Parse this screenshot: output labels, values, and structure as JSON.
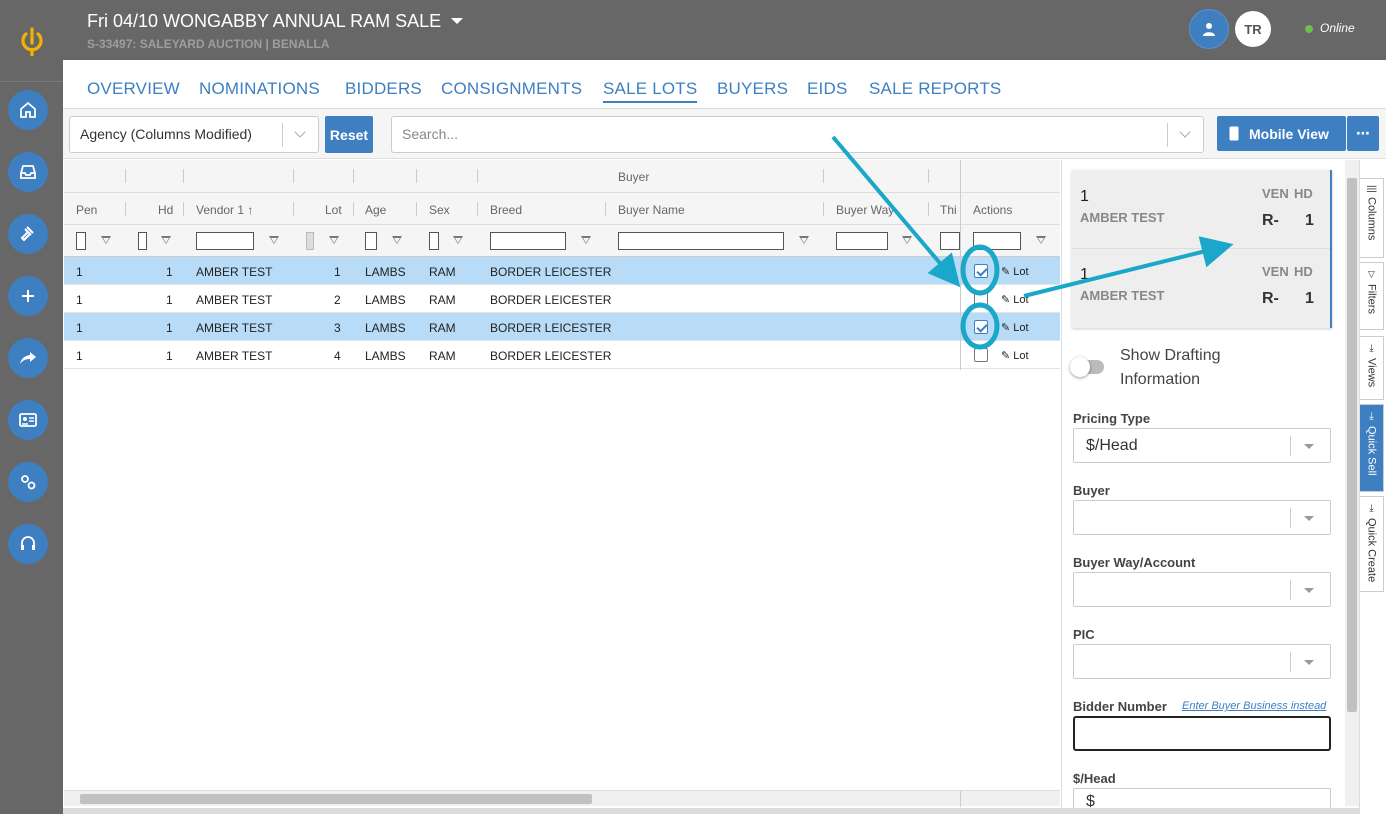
{
  "header": {
    "title": "Fri 04/10 WONGABBY ANNUAL RAM SALE",
    "subtitle": "S-33497: SALEYARD AUCTION | BENALLA",
    "avatar_initials": "TR",
    "status": "Online"
  },
  "sidebar": {
    "items": [
      {
        "icon": "home-icon"
      },
      {
        "icon": "inbox-icon"
      },
      {
        "icon": "gavel-icon"
      },
      {
        "icon": "plus-icon"
      },
      {
        "icon": "share-icon"
      },
      {
        "icon": "id-card-icon"
      },
      {
        "icon": "settings-icon"
      },
      {
        "icon": "headset-icon"
      }
    ]
  },
  "tabs": [
    {
      "label": "OVERVIEW"
    },
    {
      "label": "NOMINATIONS"
    },
    {
      "label": "BIDDERS"
    },
    {
      "label": "CONSIGNMENTS"
    },
    {
      "label": "SALE LOTS",
      "active": true
    },
    {
      "label": "BUYERS"
    },
    {
      "label": "EIDS"
    },
    {
      "label": "SALE REPORTS"
    }
  ],
  "toolbar": {
    "view_select": "Agency (Columns Modified)",
    "reset_label": "Reset",
    "search_placeholder": "Search...",
    "mobile_view_label": "Mobile View",
    "more_label": "⋯"
  },
  "grid": {
    "group_header": "Buyer",
    "columns": [
      "Pen",
      "Hd",
      "Vendor 1",
      "Lot",
      "Age",
      "Sex",
      "Breed",
      "Buyer Name",
      "Buyer Way",
      "Thi",
      "Actions"
    ],
    "sort_indicator": "↑",
    "rows": [
      {
        "pen": "1",
        "hd": "1",
        "vendor": "AMBER TEST",
        "lot": "1",
        "age": "LAMBS",
        "sex": "RAM",
        "breed": "BORDER LEICESTER",
        "checked": true,
        "action": "Lot"
      },
      {
        "pen": "1",
        "hd": "1",
        "vendor": "AMBER TEST",
        "lot": "2",
        "age": "LAMBS",
        "sex": "RAM",
        "breed": "BORDER LEICESTER",
        "checked": false,
        "action": "Lot"
      },
      {
        "pen": "1",
        "hd": "1",
        "vendor": "AMBER TEST",
        "lot": "3",
        "age": "LAMBS",
        "sex": "RAM",
        "breed": "BORDER LEICESTER",
        "checked": true,
        "action": "Lot"
      },
      {
        "pen": "1",
        "hd": "1",
        "vendor": "AMBER TEST",
        "lot": "4",
        "age": "LAMBS",
        "sex": "RAM",
        "breed": "BORDER LEICESTER",
        "checked": false,
        "action": "Lot"
      }
    ]
  },
  "quick_sell": {
    "cards": [
      {
        "num": "1",
        "name": "AMBER TEST",
        "ven_label": "VEN",
        "hd_label": "HD",
        "ven": "R-",
        "hd": "1"
      },
      {
        "num": "1",
        "name": "AMBER TEST",
        "ven_label": "VEN",
        "hd_label": "HD",
        "ven": "R-",
        "hd": "1"
      }
    ],
    "toggle_label": "Show Drafting Information",
    "pricing_type_label": "Pricing Type",
    "pricing_type_value": "$/Head",
    "buyer_label": "Buyer",
    "buyer_way_label": "Buyer Way/Account",
    "pic_label": "PIC",
    "bidder_label": "Bidder Number",
    "bidder_link": "Enter Buyer Business instead",
    "price_label": "$/Head",
    "price_prefix": "$"
  },
  "side_tabs": [
    {
      "label": "Columns"
    },
    {
      "label": "Filters"
    },
    {
      "label": "Views"
    },
    {
      "label": "Quick Sell",
      "active": true
    },
    {
      "label": "Quick Create"
    }
  ],
  "colors": {
    "accent": "#3d7fc1",
    "header_bg": "#676767",
    "selected_row": "#b8dcf7",
    "annotation": "#1aa7c9"
  }
}
